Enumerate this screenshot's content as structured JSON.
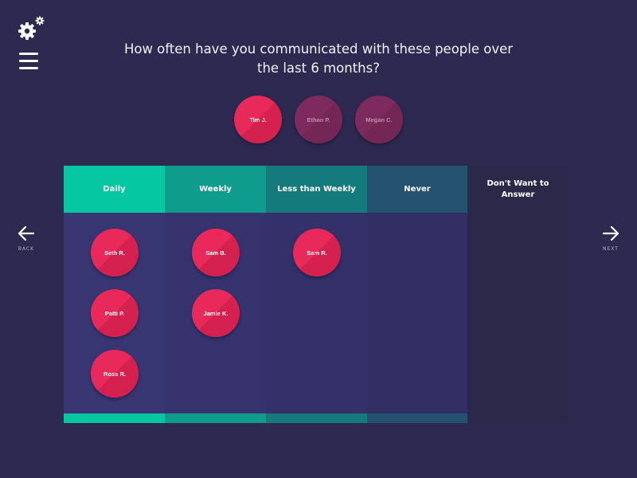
{
  "question": {
    "line1": "How often have you communicated with these people over",
    "line2": "the last 6 months?"
  },
  "pool": [
    {
      "name": "Tim J.",
      "state": "active"
    },
    {
      "name": "Ethan P.",
      "state": "dim"
    },
    {
      "name": "Megan C.",
      "state": "dim"
    }
  ],
  "columns": [
    {
      "label": "Daily",
      "people": [
        "Seth R.",
        "Patti P.",
        "Ross R."
      ]
    },
    {
      "label": "Weekly",
      "people": [
        "Sam B.",
        "Jamie K."
      ]
    },
    {
      "label": "Less than Weekly",
      "people": [
        "Sam R."
      ]
    },
    {
      "label": "Never",
      "people": []
    },
    {
      "label": "Don't Want to Answer",
      "people": []
    }
  ],
  "nav": {
    "back": "BACK",
    "next": "NEXT"
  },
  "colors": {
    "background": "#2e2951",
    "accent_pink": "#e8295a",
    "daily": "#06c8a0",
    "weekly": "#0e9d8c",
    "less_than_weekly": "#157a7b",
    "never": "#25526e",
    "dont_want": "#2b2849"
  },
  "icons": {
    "settings": "gears-icon",
    "menu": "hamburger-icon",
    "back": "arrow-left-icon",
    "next": "arrow-right-icon"
  }
}
